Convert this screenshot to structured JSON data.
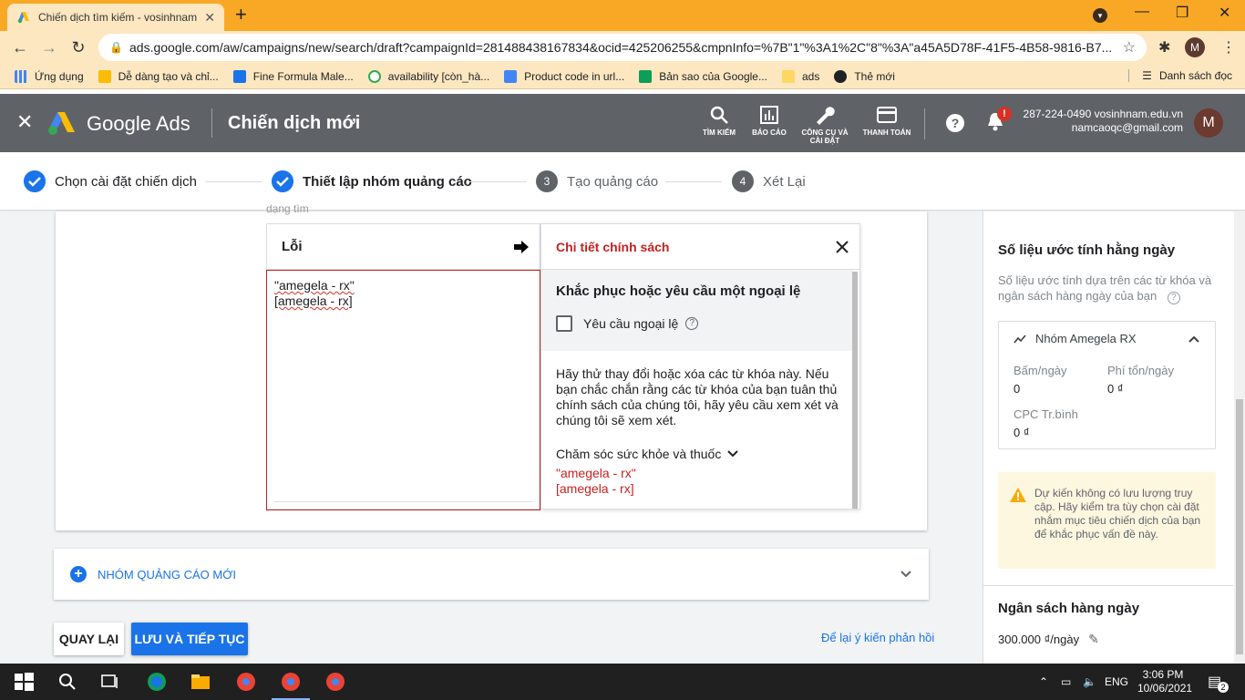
{
  "browser": {
    "tab_title": "Chiến dịch tìm kiếm - vosinhnam",
    "tab_close": "✕",
    "new_tab": "+",
    "url": "ads.google.com/aw/campaigns/new/search/draft?campaignId=281488438167834&ocid=425206255&cmpnInfo=%7B\"1\"%3A1%2C\"8\"%3A\"a45A5D78F-41F5-4B58-9816-B7...",
    "profile_initial": "M",
    "bookmarks": [
      {
        "label": "Ứng dụng",
        "color": "#4285f4"
      },
      {
        "label": "Dễ dàng tạo và chỉ...",
        "color": "#fbbc04"
      },
      {
        "label": "Fine Formula Male...",
        "color": "#1a73e8"
      },
      {
        "label": "availability [còn_hà...",
        "color": "#34a853"
      },
      {
        "label": "Product code in url...",
        "color": "#4285f4"
      },
      {
        "label": "Bản sao của Google...",
        "color": "#0f9d58"
      },
      {
        "label": "ads",
        "color": "#fdd663"
      },
      {
        "label": "Thẻ mới",
        "color": "#202124"
      }
    ],
    "reading_list": "Danh sách đọc"
  },
  "ads_header": {
    "brand": "Google Ads",
    "page_title": "Chiến dịch mới",
    "tools": [
      {
        "label": "TÌM KIẾM",
        "icon": "search-icon"
      },
      {
        "label": "BÁO CÁO",
        "icon": "reports-icon"
      },
      {
        "label": "CÔNG CỤ VÀ CÀI ĐẶT",
        "icon": "wrench-icon"
      },
      {
        "label": "THANH TOÁN",
        "icon": "billing-icon"
      }
    ],
    "notif_count": "!",
    "account_line1": "287-224-0490 vosinhnam.edu.vn",
    "account_line2": "namcaoqc@gmail.com",
    "avatar_initial": "M"
  },
  "stepper": {
    "steps": [
      {
        "label": "Chọn cài đặt chiến dịch",
        "state": "done"
      },
      {
        "label": "Thiết lập nhóm quảng cáo",
        "state": "done"
      },
      {
        "label": "Tạo quảng cáo",
        "num": "3"
      },
      {
        "label": "Xét Lại",
        "num": "4"
      }
    ]
  },
  "editor": {
    "cut_text": "dạng tìm",
    "errors_title": "Lỗi",
    "keywords": [
      "\"amegela - rx\"",
      "[amegela - rx]"
    ]
  },
  "policy": {
    "title": "Chi tiết chính sách",
    "fix_title": "Khắc phục hoặc yêu cầu một ngoại lệ",
    "exception_label": "Yêu cầu ngoại lệ",
    "description": "Hãy thử thay đổi hoặc xóa các từ khóa này. Nếu bạn chắc chắn rằng các từ khóa của bạn tuân thủ chính sách của chúng tôi, hãy yêu cầu xem xét và chúng tôi sẽ xem xét.",
    "category": "Chăm sóc sức khỏe và thuốc",
    "keywords": [
      "\"amegela - rx\"",
      "[amegela - rx]"
    ]
  },
  "new_group": {
    "label": "NHÓM QUẢNG CÁO MỚI"
  },
  "actions": {
    "back": "QUAY LẠI",
    "save": "LƯU VÀ TIẾP TỤC",
    "feedback": "Để lại ý kiến phản hồi"
  },
  "sidebar": {
    "title": "Số liệu ước tính hằng ngày",
    "subtitle": "Số liệu ước tính dựa trên các từ khóa và ngân sách hàng ngày của bạn",
    "group_name": "Nhóm Amegela RX",
    "clicks_label": "Bấm/ngày",
    "clicks_value": "0",
    "cost_label": "Phí tổn/ngày",
    "cost_value": "0 ₫",
    "cpc_label": "CPC Tr.bình",
    "cpc_value": "0 ₫",
    "warning": "Dự kiến không có lưu lượng truy cập. Hãy kiểm tra tùy chọn cài đặt nhắm mục tiêu chiến dịch của bạn để khắc phục vấn đề này.",
    "budget_title": "Ngân sách hàng ngày",
    "budget_value": "300.000 ₫/ngày"
  },
  "taskbar": {
    "language": "ENG",
    "time": "3:06 PM",
    "date": "10/06/2021",
    "notif_count": "2"
  }
}
